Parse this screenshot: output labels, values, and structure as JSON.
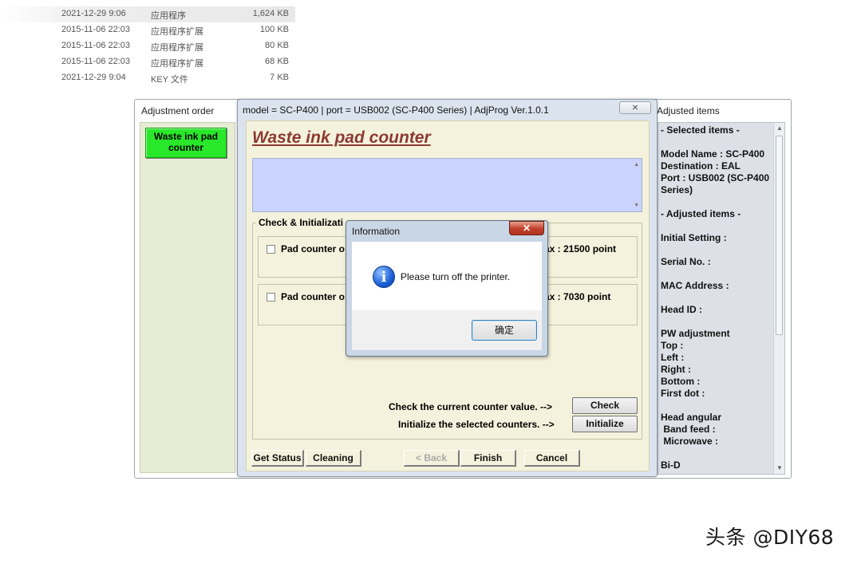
{
  "file_list": [
    {
      "date": "2021-12-29 9:06",
      "type": "应用程序",
      "size": "1,624 KB"
    },
    {
      "date": "2015-11-06 22:03",
      "type": "应用程序扩展",
      "size": "100 KB"
    },
    {
      "date": "2015-11-06 22:03",
      "type": "应用程序扩展",
      "size": "80 KB"
    },
    {
      "date": "2015-11-06 22:03",
      "type": "应用程序扩展",
      "size": "68 KB"
    },
    {
      "date": "2021-12-29 9:04",
      "type": "KEY 文件",
      "size": "7 KB"
    }
  ],
  "left_panel": {
    "title": "Adjustment order",
    "selected_item": "Waste ink pad counter"
  },
  "main_window": {
    "title": "model = SC-P400 | port = USB002 (SC-P400 Series) | AdjProg Ver.1.0.1",
    "close_glyph": "⨯",
    "heading": "Waste ink pad counter",
    "group_label": "Check & Initializati",
    "counters": [
      {
        "label": "Pad counter o",
        "max": "ax : 21500 point"
      },
      {
        "label": "Pad counter o",
        "max": "ax : 7030 point"
      }
    ],
    "check_text": "Check the current counter value.  -->",
    "check_button": "Check",
    "init_text": "Initialize the selected counters.  -->",
    "init_button": "Initialize",
    "buttons": {
      "get_status": "Get Status",
      "cleaning": "Cleaning",
      "back": "< Back",
      "finish": "Finish",
      "cancel": "Cancel"
    }
  },
  "right_panel": {
    "title": "Adjusted items",
    "lines": [
      "- Selected items -",
      "",
      "Model Name : SC-P400",
      "Destination : EAL",
      "Port : USB002 (SC-P400",
      "Series)",
      "",
      "- Adjusted items -",
      "",
      "Initial Setting :",
      "",
      "Serial No. :",
      "",
      "MAC Address :",
      "",
      "Head ID :",
      "",
      "PW adjustment",
      "Top :",
      "Left :",
      "Right :",
      "Bottom :",
      "First dot :",
      "",
      "Head angular",
      " Band feed :",
      " Microwave :",
      "",
      "Bi-D"
    ]
  },
  "info_dialog": {
    "title": "Information",
    "close_glyph": "✕",
    "icon": "info-icon",
    "icon_glyph": "i",
    "message": "Please turn off the printer.",
    "ok_button": "确定"
  },
  "watermark": "头条 @DIY68"
}
